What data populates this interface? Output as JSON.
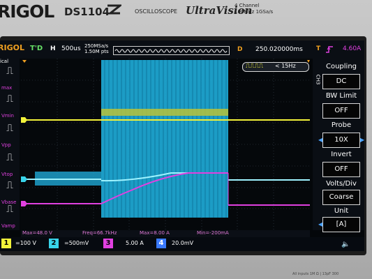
{
  "device": {
    "brand": "RIGOL",
    "model": "DS1104",
    "type": "OSCILLOSCOPE",
    "series": "UltraVision",
    "channels": "4 Channel",
    "bandwidth": "100MHz",
    "sample_rate": "1GSa/s",
    "input_spec": "All inputs 1M Ω | 13pF 300"
  },
  "status_bar": {
    "brand": "RIGOL",
    "mode": "T'D",
    "timebase_label": "H",
    "timebase": "500us",
    "sample_rate": "250MSa/s",
    "memory_depth": "1.50M pts",
    "delay_label": "D",
    "delay": "250.020000ms",
    "trigger_label": "T",
    "trigger_level": "4.60A"
  },
  "left_menu": {
    "header": "ical",
    "items": [
      {
        "label": "max"
      },
      {
        "label": "Vmin"
      },
      {
        "label": "Vpp"
      },
      {
        "label": "Vtop"
      },
      {
        "label": "Vbase"
      },
      {
        "label": "Vamp"
      }
    ]
  },
  "freq_counter": "< 15Hz",
  "right_menu": {
    "channel": "CH3",
    "items": [
      {
        "title": "Coupling",
        "value": "DC"
      },
      {
        "title": "BW Limit",
        "value": "OFF"
      },
      {
        "title": "Probe",
        "value": "10X"
      },
      {
        "title": "Invert",
        "value": "OFF"
      },
      {
        "title": "Volts/Div",
        "value": "Coarse"
      },
      {
        "title": "Unit",
        "value": "[A]"
      }
    ]
  },
  "measurements": {
    "max": "Max=48.0 V",
    "freq": "Freq=66.7kHz",
    "max_current": "Max=8.00 A",
    "min": "Min=-200mA"
  },
  "channels": [
    {
      "num": "1",
      "scale": "=100 V",
      "color": "#f2f23a"
    },
    {
      "num": "2",
      "scale": "=500mV",
      "color": "#38d4ea"
    },
    {
      "num": "3",
      "scale": "5.00 A",
      "color": "#e040e0"
    },
    {
      "num": "4",
      "scale": "20.0mV",
      "color": "#3a7aff"
    }
  ],
  "colors": {
    "ch1": "#f2f23a",
    "ch2": "#38d4ea",
    "ch3": "#e040e0",
    "ch4": "#3a7aff",
    "accent": "#f0a020",
    "grid": "#3a4450"
  }
}
